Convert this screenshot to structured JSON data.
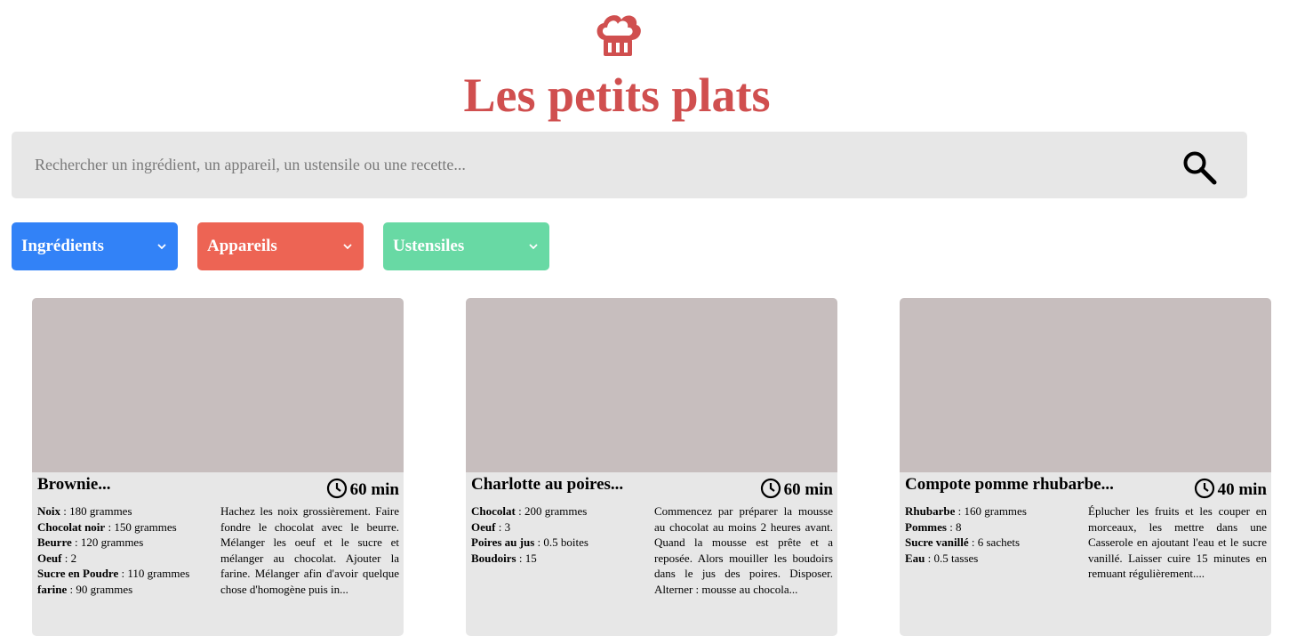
{
  "site": {
    "title": "Les petits plats"
  },
  "search": {
    "placeholder": "Rechercher un ingrédient, un appareil, un ustensile ou une recette..."
  },
  "filters": [
    {
      "label": "Ingrédients",
      "color": "#3282F7"
    },
    {
      "label": "Appareils",
      "color": "#ED6454"
    },
    {
      "label": "Ustensiles",
      "color": "#68D9A4"
    }
  ],
  "recipes": [
    {
      "title": "Brownie...",
      "time": "60 min",
      "ingredients": [
        {
          "name": "Noix",
          "qty": " : 180 grammes"
        },
        {
          "name": "Chocolat noir",
          "qty": " : 150 grammes"
        },
        {
          "name": "Beurre",
          "qty": " : 120 grammes"
        },
        {
          "name": "Oeuf",
          "qty": " : 2"
        },
        {
          "name": "Sucre en Poudre",
          "qty": " : 110 grammes"
        },
        {
          "name": "farine",
          "qty": " : 90 grammes"
        }
      ],
      "description": "Hachez les noix grossièrement. Faire fondre le chocolat avec le beurre. Mélanger les oeuf et le sucre et mélanger au chocolat. Ajouter la farine. Mélanger afin d'avoir quelque chose d'homogène puis in..."
    },
    {
      "title": "Charlotte au poires...",
      "time": "60 min",
      "ingredients": [
        {
          "name": "Chocolat",
          "qty": " : 200 grammes"
        },
        {
          "name": "Oeuf",
          "qty": " : 3"
        },
        {
          "name": "Poires au jus",
          "qty": " : 0.5 boites"
        },
        {
          "name": "Boudoirs",
          "qty": " : 15"
        }
      ],
      "description": "Commencez par préparer la mousse au chocolat au moins 2 heures avant. Quand la mousse est prête et a reposée. Alors mouiller les boudoirs dans le jus des poires. Disposer. Alterner : mousse au chocola..."
    },
    {
      "title": "Compote pomme rhubarbe...",
      "time": "40 min",
      "ingredients": [
        {
          "name": "Rhubarbe",
          "qty": " : 160 grammes"
        },
        {
          "name": "Pommes",
          "qty": " : 8"
        },
        {
          "name": "Sucre vanillé",
          "qty": " : 6 sachets"
        },
        {
          "name": "Eau",
          "qty": " : 0.5 tasses"
        }
      ],
      "description": "Éplucher les fruits et les couper en morceaux, les mettre dans une Casserole en ajoutant l'eau et le sucre vanillé. Laisser cuire 15 minutes en remuant régulièrement...."
    }
  ]
}
